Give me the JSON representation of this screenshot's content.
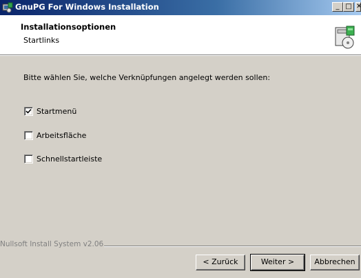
{
  "window": {
    "title": "GnuPG For Windows Installation",
    "icon": "installer-icon",
    "controls": [
      "minimize",
      "maximize",
      "close"
    ]
  },
  "header": {
    "title": "Installationsoptionen",
    "subtitle": "Startlinks",
    "icon": "install-cd-icon"
  },
  "main": {
    "instruction": "Bitte wählen Sie, welche Verknüpfungen angelegt werden sollen:",
    "options": [
      {
        "label": "Startmenü",
        "checked": true
      },
      {
        "label": "Arbeitsfläche",
        "checked": false
      },
      {
        "label": "Schnellstartleiste",
        "checked": false
      }
    ]
  },
  "footer": {
    "branding": "Nullsoft Install System v2.06",
    "back_label": "< Zurück",
    "next_label": "Weiter >",
    "cancel_label": "Abbrechen"
  }
}
